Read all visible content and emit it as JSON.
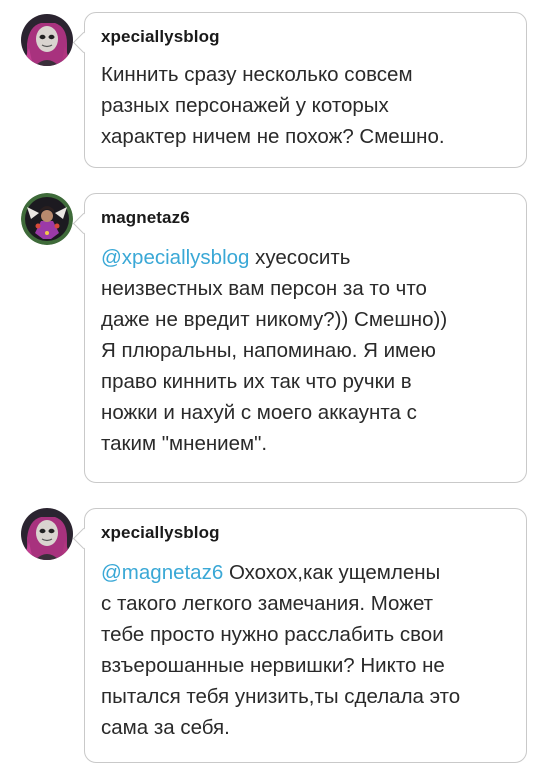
{
  "replies": [
    {
      "username": "xpeciallysblog",
      "avatar_icon": "pink-haired-masked-avatar-icon",
      "mention": "",
      "text": "Киннить сразу несколько  совсем\nразных персонажей у которых\nхарактер ничем не похож? Смешно."
    },
    {
      "username": "magnetaz6",
      "avatar_icon": "green-ringed-character-avatar-icon",
      "mention": "@xpeciallysblog",
      "text": " хуесосить\nнеизвестных вам персон за то что\nдаже не вредит никому?)) Смешно))\nЯ плюральны, напоминаю. Я имею\nправо киннить их так что ручки в\nножки и нахуй с моего аккаунта с\nтаким \"мнением\"."
    },
    {
      "username": "xpeciallysblog",
      "avatar_icon": "pink-haired-masked-avatar-icon",
      "mention": "@magnetaz6",
      "text": " Охохох,как ущемлены\nс такого легкого замечания. Может\nтебе просто нужно расслабить свои\nвзъерошанные нервишки? Никто не\nпытался тебя унизить,ты сделала это\nсама за себя."
    }
  ],
  "colors": {
    "mention": "#3aa8d6",
    "border": "#c9c9c9",
    "text": "#2a2a2a"
  }
}
